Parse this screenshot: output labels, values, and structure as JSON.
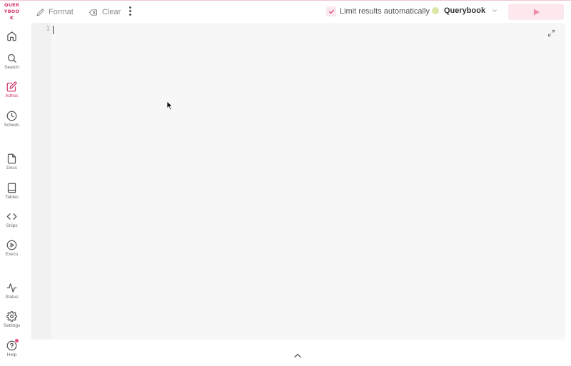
{
  "app": {
    "logo_text": "QUERYBOOK",
    "logo_lines": [
      "QUER",
      "YBOO",
      "K"
    ]
  },
  "sidebar": {
    "items": [
      {
        "name": "home",
        "label": "",
        "icon": "home-icon"
      },
      {
        "name": "search",
        "label": "Search",
        "icon": "search-icon"
      },
      {
        "name": "adhoc",
        "label": "Adhoc",
        "icon": "edit-icon",
        "active": true
      },
      {
        "name": "scheds",
        "label": "Scheds",
        "icon": "clock-icon"
      },
      {
        "name": "docs",
        "label": "Docs",
        "icon": "file-icon"
      },
      {
        "name": "tables",
        "label": "Tables",
        "icon": "book-icon"
      },
      {
        "name": "snips",
        "label": "Snips",
        "icon": "code-icon"
      },
      {
        "name": "execs",
        "label": "Execs",
        "icon": "play-circle-icon"
      },
      {
        "name": "status",
        "label": "Status",
        "icon": "activity-icon"
      },
      {
        "name": "settings",
        "label": "Settings",
        "icon": "gear-icon"
      },
      {
        "name": "help",
        "label": "Help",
        "icon": "help-circle-icon"
      }
    ]
  },
  "toolbar": {
    "format_label": "Format",
    "clear_label": "Clear",
    "limit_label": "Limit results automatically",
    "limit_checked": true,
    "engine_label": "Querybook",
    "engine_status_color": "#dde6a8",
    "run_icon": "play-icon"
  },
  "editor": {
    "line_numbers": [
      "1"
    ],
    "content": ""
  },
  "colors": {
    "accent": "#d4376b",
    "accent_light": "#fde8ee",
    "editor_bg": "#f7f7f7"
  }
}
